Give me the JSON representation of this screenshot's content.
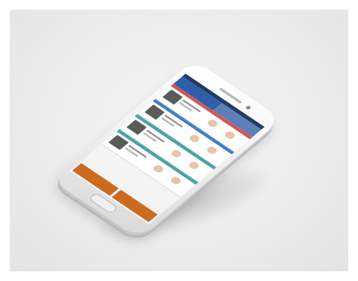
{
  "scene": {
    "description_tokens": [],
    "device": "smartphone",
    "background_color": "#ececec"
  },
  "app": {
    "header_colors": [
      "#2f5fa8",
      "#5d7fb8"
    ],
    "rows": [
      {
        "stripe_color": "#d9534f"
      },
      {
        "stripe_color": "#3f7fc6"
      },
      {
        "stripe_color": "#4aa3a8"
      },
      {
        "stripe_color": "#4aa3a8"
      }
    ],
    "bottom_buttons_color": "#cc6a1f"
  }
}
